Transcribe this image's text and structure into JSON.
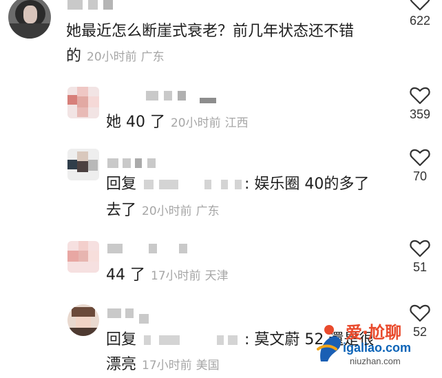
{
  "comments": [
    {
      "text": "她最近怎么断崖式衰老？前几年状态还不错",
      "text_line2": "的",
      "time": "20小时前",
      "location": "广东",
      "likes": "622"
    },
    {
      "text": "她 40 了",
      "time": "20小时前",
      "location": "江西",
      "likes": "359"
    },
    {
      "reply_prefix": "回复",
      "text": ": 娱乐圈 40的多了",
      "text_line2": "去了",
      "time": "20小时前",
      "location": "广东",
      "likes": "70"
    },
    {
      "text": "44 了",
      "time": "17小时前",
      "location": "天津",
      "likes": "51"
    },
    {
      "reply_prefix": "回复",
      "text": ": 莫文蔚 52 還是很",
      "text_line2": "漂亮",
      "time": "17小时前",
      "location": "美国",
      "likes": "52"
    }
  ],
  "watermark": {
    "top": "爱·尬聊",
    "url": "igaliao.com",
    "sub": "niuzhan.com"
  },
  "colors": {
    "text": "#1f1f1f",
    "meta": "#a6a6a6",
    "heart": "#333333",
    "watermark_red": "#e94a2c",
    "watermark_blue": "#0b63b7"
  }
}
